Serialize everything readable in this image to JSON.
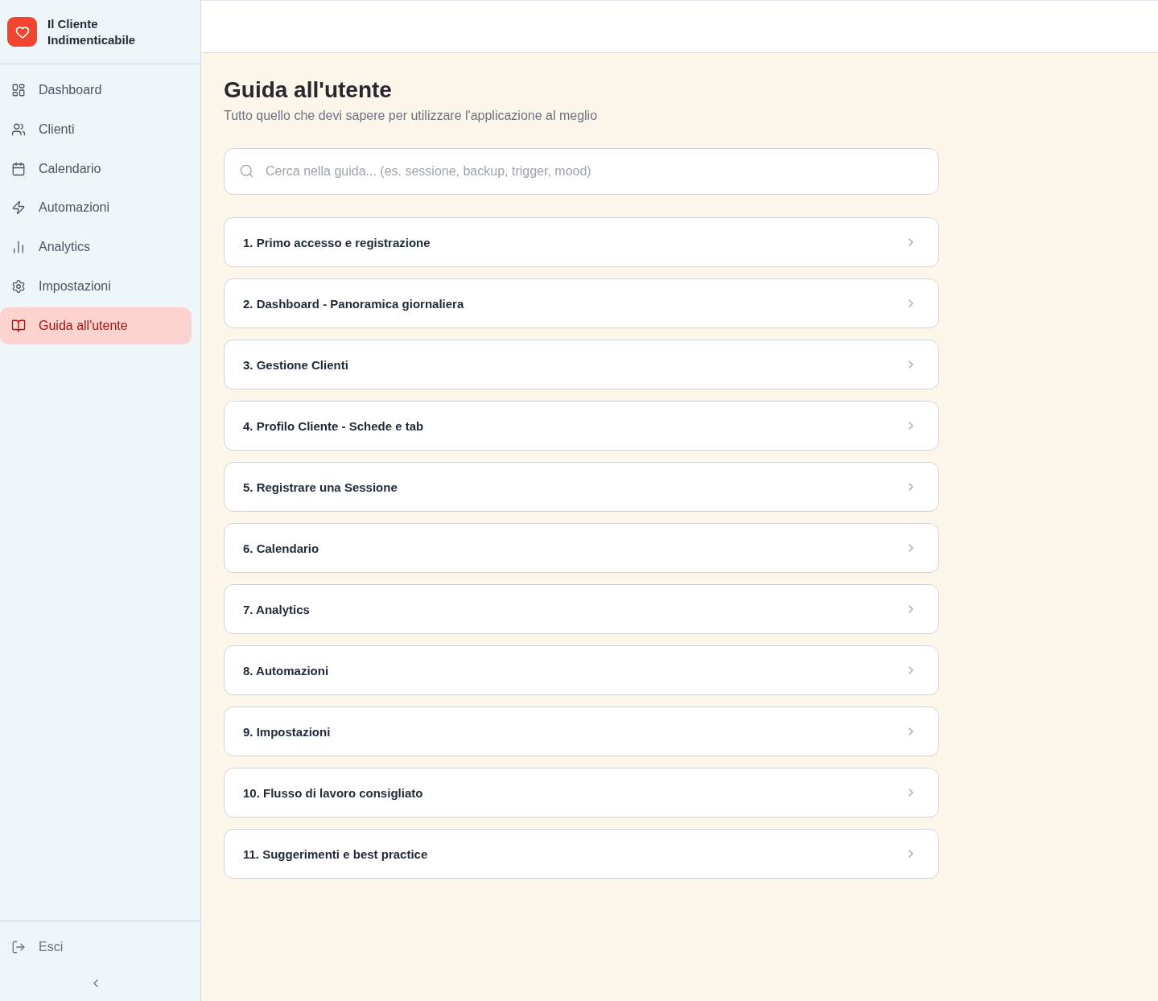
{
  "app": {
    "name": "Il Cliente Indimenticabile"
  },
  "sidebar": {
    "items": [
      {
        "label": "Dashboard",
        "selected": false
      },
      {
        "label": "Clienti",
        "selected": false
      },
      {
        "label": "Calendario",
        "selected": false
      },
      {
        "label": "Automazioni",
        "selected": false
      },
      {
        "label": "Analytics",
        "selected": false
      },
      {
        "label": "Impostazioni",
        "selected": false
      },
      {
        "label": "Guida all'utente",
        "selected": true
      }
    ],
    "logout": "Esci"
  },
  "page": {
    "title": "Guida all'utente",
    "subtitle": "Tutto quello che devi sapere per utilizzare l'applicazione al meglio"
  },
  "search": {
    "placeholder": "Cerca nella guida... (es. sessione, backup, trigger, mood)"
  },
  "sections": [
    {
      "title": "1. Primo accesso e registrazione",
      "expanded": false
    },
    {
      "title": "2. Dashboard - Panoramica giornaliera",
      "expanded": false
    },
    {
      "title": "3. Gestione Clienti",
      "expanded": false
    },
    {
      "title": "4. Profilo Cliente - Schede e tab",
      "expanded": false
    },
    {
      "title": "5. Registrare una Sessione",
      "expanded": false
    },
    {
      "title": "6. Calendario",
      "expanded": false
    },
    {
      "title": "7. Analytics",
      "expanded": false
    },
    {
      "title": "8. Automazioni",
      "expanded": false
    },
    {
      "title": "9. Impostazioni",
      "expanded": false
    },
    {
      "title": "10. Flusso di lavoro consigliato",
      "expanded": false
    },
    {
      "title": "11. Suggerimenti e best practice",
      "expanded": false
    }
  ]
}
